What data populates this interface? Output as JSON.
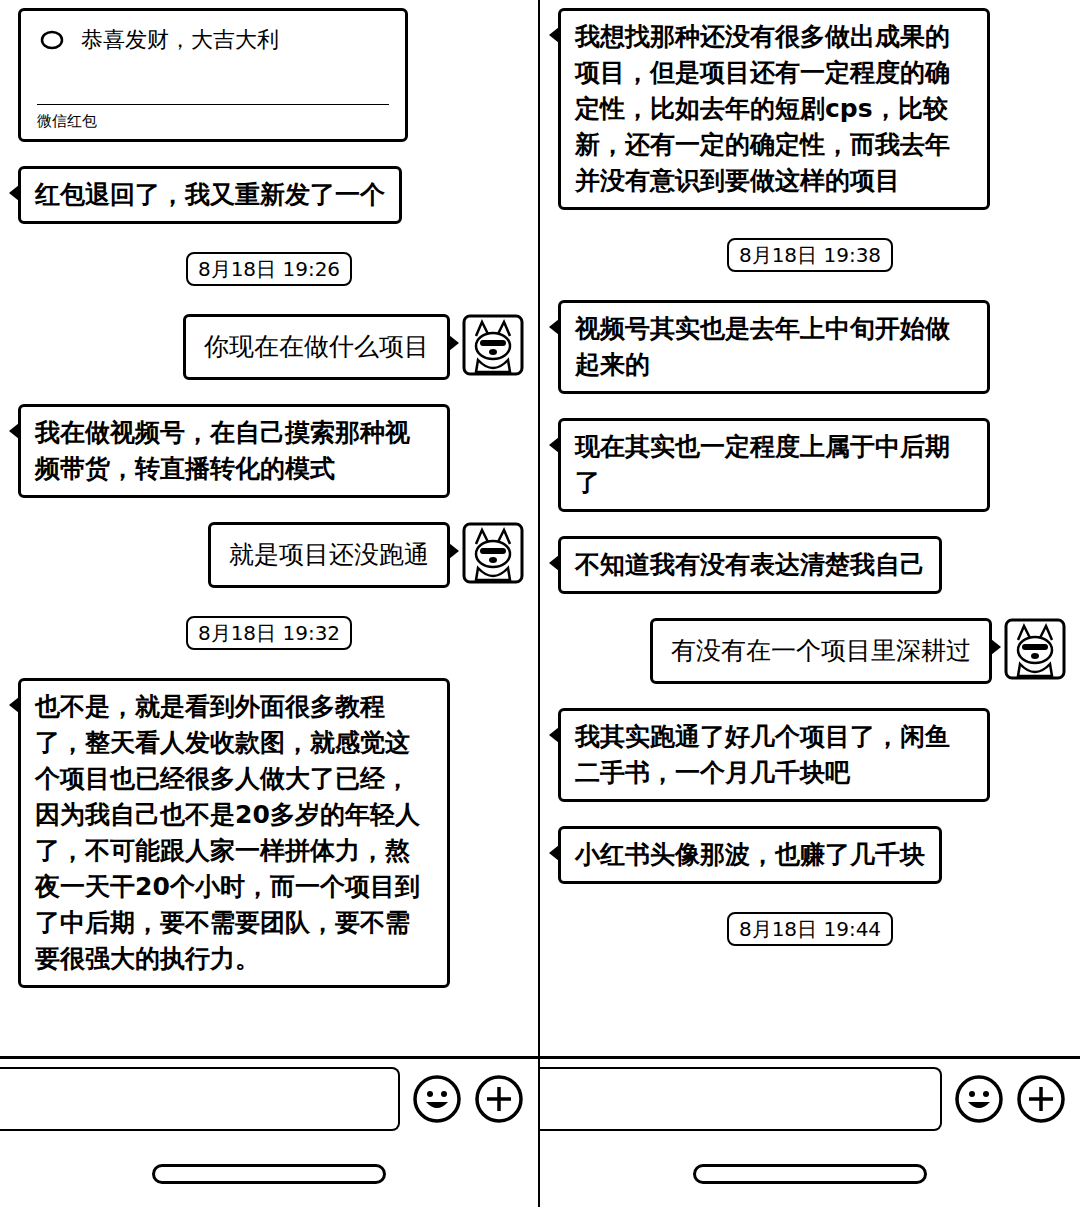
{
  "panels": [
    {
      "messages": [
        {
          "kind": "redpacket",
          "text": "恭喜发财，大吉大利",
          "sub": "微信红包"
        },
        {
          "kind": "received",
          "text": "红包退回了，我又重新发了一个"
        },
        {
          "kind": "time",
          "text": "8月18日 19:26"
        },
        {
          "kind": "sent",
          "text": "你现在在做什么项目"
        },
        {
          "kind": "received",
          "text": "我在做视频号，在自己摸索那种视频带货，转直播转化的模式"
        },
        {
          "kind": "sent",
          "text": "就是项目还没跑通"
        },
        {
          "kind": "time",
          "text": "8月18日 19:32"
        },
        {
          "kind": "received",
          "text": "也不是，就是看到外面很多教程了，整天看人发收款图，就感觉这个项目也已经很多人做大了已经，因为我自己也不是20多岁的年轻人了，不可能跟人家一样拼体力，熬夜一天干20个小时，而一个项目到了中后期，要不需要团队，要不需要很强大的执行力。"
        }
      ]
    },
    {
      "messages": [
        {
          "kind": "received",
          "text": "我想找那种还没有很多做出成果的项目，但是项目还有一定程度的确定性，比如去年的短剧cps，比较新，还有一定的确定性，而我去年并没有意识到要做这样的项目"
        },
        {
          "kind": "time",
          "text": "8月18日 19:38"
        },
        {
          "kind": "received",
          "text": "视频号其实也是去年上中旬开始做起来的"
        },
        {
          "kind": "received",
          "text": "现在其实也一定程度上属于中后期了"
        },
        {
          "kind": "received",
          "text": "不知道我有没有表达清楚我自己"
        },
        {
          "kind": "sent",
          "text": "有没有在一个项目里深耕过"
        },
        {
          "kind": "received",
          "text": "我其实跑通了好几个项目了，闲鱼二手书，一个月几千块吧"
        },
        {
          "kind": "received",
          "text": "小红书头像那波，也赚了几千块"
        },
        {
          "kind": "time",
          "text": "8月18日 19:44"
        }
      ]
    }
  ]
}
